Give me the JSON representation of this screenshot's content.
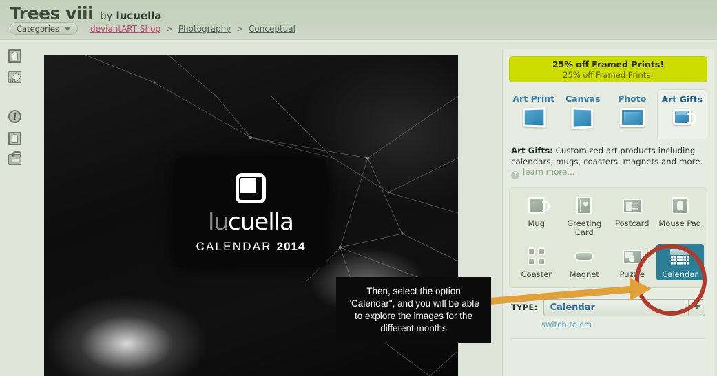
{
  "header": {
    "title": "Trees viii",
    "by_label": "by",
    "author": "lucuella",
    "categories_button": "Categories",
    "breadcrumb": {
      "shop": "deviantART Shop",
      "sep1": ">",
      "photography": "Photography",
      "sep2": ">",
      "conceptual": "Conceptual"
    }
  },
  "sidebar": {
    "items": [
      {
        "name": "print-preview-icon",
        "label": "Print preview"
      },
      {
        "name": "edit-icon",
        "label": "Edit"
      },
      {
        "name": "info-icon",
        "label": "Info"
      },
      {
        "name": "framed-print-icon",
        "label": "Framed print"
      },
      {
        "name": "shopping-bag-icon",
        "label": "Shopping bag"
      }
    ]
  },
  "artwork": {
    "logo_word_dim": "lu",
    "logo_word_bright": "cuella",
    "logo_sub_prefix": "CALENDAR",
    "logo_sub_year": "2014"
  },
  "callout": {
    "text": "Then, select the option \"Calendar\", and you will be able to explore the images for the different months"
  },
  "panel": {
    "promo": {
      "headline": "25% off Framed Prints!",
      "subline": "25% off Framed Prints!",
      "background": "#cddd00"
    },
    "tabs": [
      {
        "label": "Art Print",
        "icon": "art-print-icon",
        "active": false
      },
      {
        "label": "Canvas",
        "icon": "canvas-icon",
        "active": false
      },
      {
        "label": "Photo",
        "icon": "photo-icon",
        "active": false
      },
      {
        "label": "Art Gifts",
        "icon": "mug-icon",
        "active": true
      }
    ],
    "description": {
      "lead": "Art Gifts:",
      "body": " Customized art products including calendars, mugs, coasters, magnets and more.",
      "learn_more": "learn more..."
    },
    "products_row1": [
      {
        "label": "Mug",
        "icon": "mug-icon",
        "selected": false
      },
      {
        "label": "Greeting Card",
        "icon": "greeting-card-icon",
        "selected": false
      },
      {
        "label": "Postcard",
        "icon": "postcard-icon",
        "selected": false
      },
      {
        "label": "Mouse Pad",
        "icon": "mouse-pad-icon",
        "selected": false
      }
    ],
    "products_row2": [
      {
        "label": "Coaster",
        "icon": "coaster-icon",
        "selected": false
      },
      {
        "label": "Magnet",
        "icon": "magnet-icon",
        "selected": false
      },
      {
        "label": "Puzzle",
        "icon": "puzzle-icon",
        "selected": false
      },
      {
        "label": "Calendar",
        "icon": "calendar-icon",
        "selected": true
      }
    ],
    "type": {
      "label": "TYPE:",
      "value": "Calendar",
      "switch_units": "switch to cm"
    }
  },
  "annotation": {
    "ring_color": "#b03a2e",
    "arrow_color": "#e0a03a"
  }
}
